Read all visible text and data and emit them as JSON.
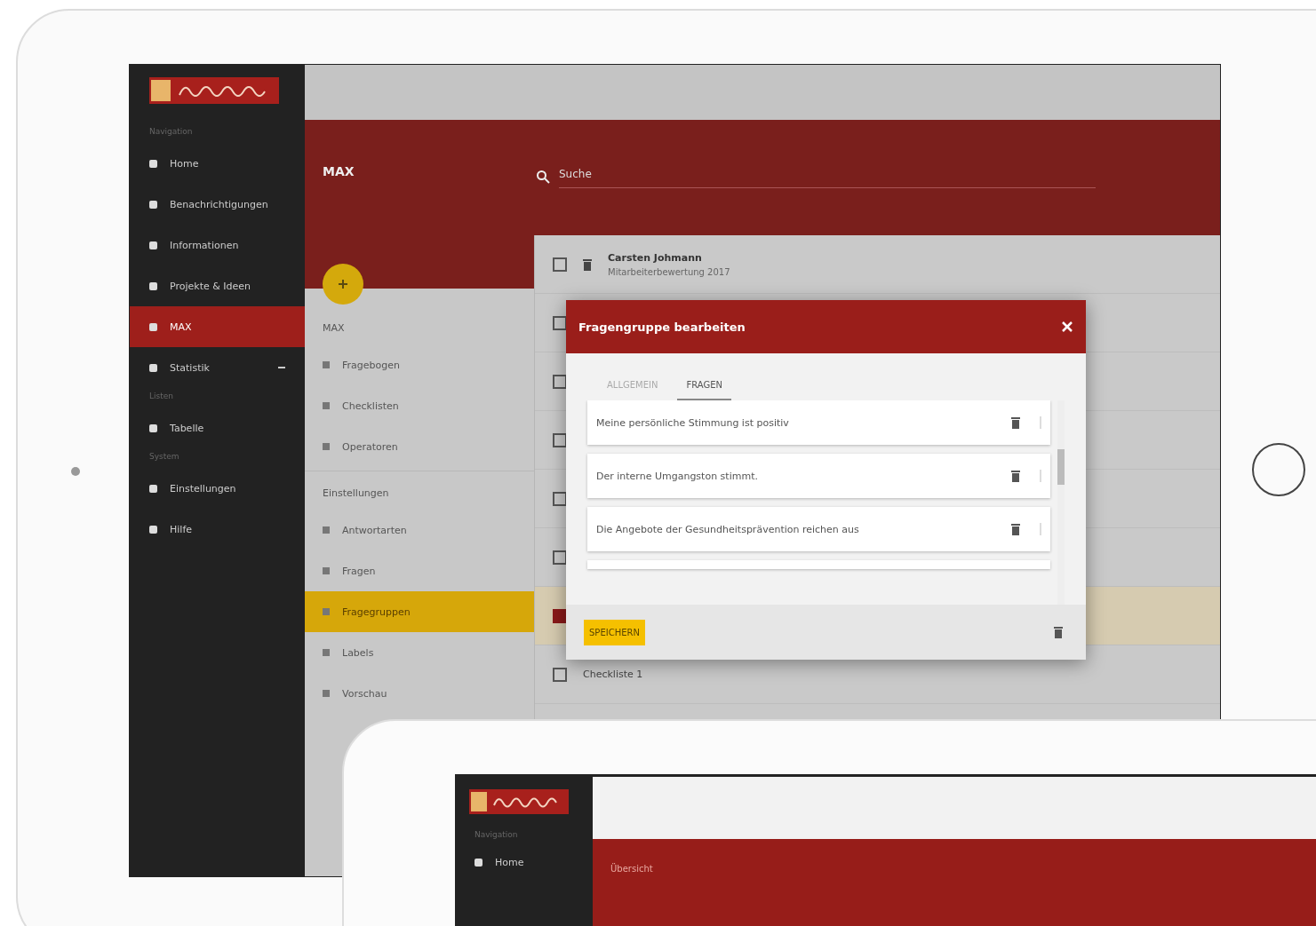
{
  "sidebar": {
    "groups": [
      {
        "header": "Navigation",
        "items": [
          {
            "label": "Home",
            "selected": false,
            "expandable": false
          },
          {
            "label": "Benachrichtigungen",
            "selected": false,
            "expandable": false
          },
          {
            "label": "Informationen",
            "selected": false,
            "expandable": false
          },
          {
            "label": "Projekte & Ideen",
            "selected": false,
            "expandable": false
          },
          {
            "label": "MAX",
            "selected": true,
            "expandable": false
          },
          {
            "label": "Statistik",
            "selected": false,
            "expandable": true
          }
        ]
      },
      {
        "header": "Listen",
        "items": [
          {
            "label": "Tabelle",
            "selected": false,
            "expandable": false
          }
        ]
      },
      {
        "header": "System",
        "items": [
          {
            "label": "Einstellungen",
            "selected": false,
            "expandable": false
          },
          {
            "label": "Hilfe",
            "selected": false,
            "expandable": false
          }
        ]
      }
    ]
  },
  "header": {
    "title": "MAX",
    "search": {
      "placeholder": "Suche"
    }
  },
  "subnav": {
    "groups": [
      {
        "header": "MAX",
        "items": [
          {
            "label": "Fragebogen",
            "selected": false
          },
          {
            "label": "Checklisten",
            "selected": false
          },
          {
            "label": "Operatoren",
            "selected": false
          }
        ]
      },
      {
        "header": "Einstellungen",
        "items": [
          {
            "label": "Antwortarten",
            "selected": false
          },
          {
            "label": "Fragen",
            "selected": false
          },
          {
            "label": "Fragegruppen",
            "selected": true
          },
          {
            "label": "Labels",
            "selected": false
          },
          {
            "label": "Vorschau",
            "selected": false
          }
        ]
      }
    ]
  },
  "list": {
    "rows": [
      {
        "title": "Carsten Johmann",
        "subtitle": "Mitarbeiterbewertung 2017",
        "checked": false,
        "selected": false
      },
      {
        "checked": false,
        "selected": false
      },
      {
        "checked": false,
        "selected": false
      },
      {
        "checked": false,
        "selected": false
      },
      {
        "checked": false,
        "selected": false
      },
      {
        "checked": false,
        "selected": false
      },
      {
        "checked": true,
        "selected": true
      },
      {
        "title": "Checkliste 1",
        "checked": false,
        "selected": false
      }
    ]
  },
  "dialog": {
    "title": "Fragengruppe bearbeiten",
    "tabs": [
      {
        "label": "ALLGEMEIN",
        "selected": false
      },
      {
        "label": "FRAGEN",
        "selected": true
      }
    ],
    "questions": [
      "Meine persönliche Stimmung ist positiv",
      "Der interne Umgangston stimmt.",
      "Die Angebote der Gesundheitsprävention reichen aus"
    ],
    "save_button": "SPEICHERN"
  },
  "second_tablet": {
    "header": "Übersicht",
    "sidebar_header": "Navigation",
    "items": [
      "Home"
    ]
  }
}
